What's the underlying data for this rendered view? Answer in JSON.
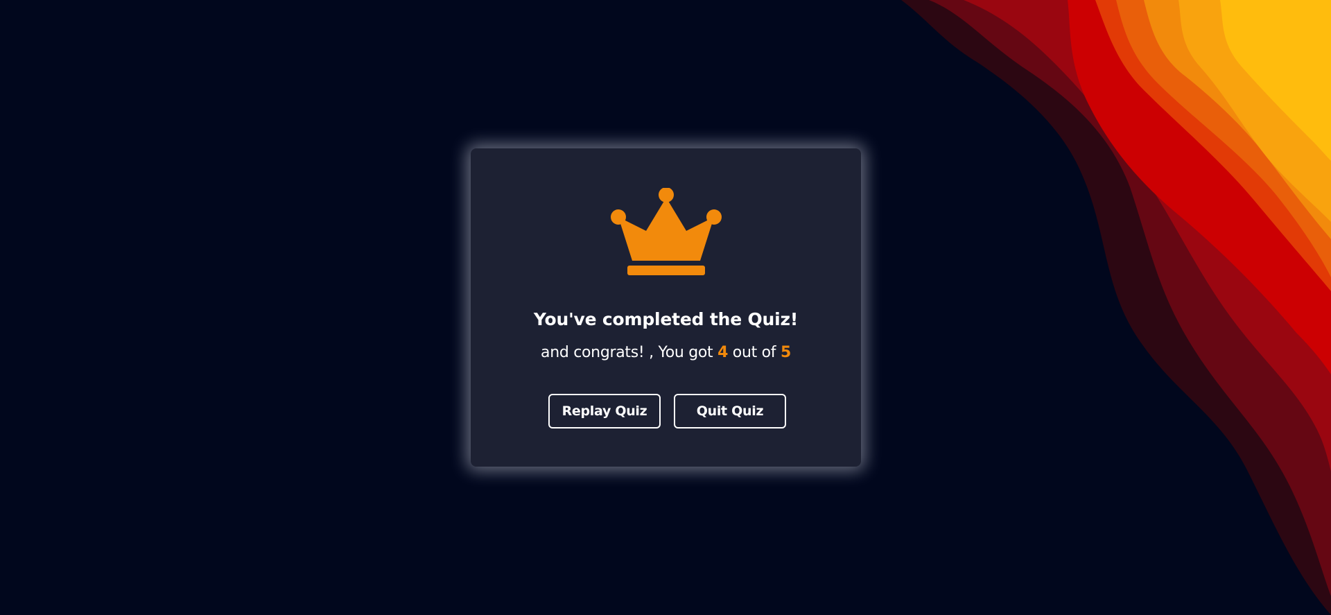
{
  "result": {
    "title": "You've completed the Quiz!",
    "score_prefix": "and congrats! , You got",
    "score_value": "4",
    "score_middle": "out of",
    "score_total": "5"
  },
  "buttons": {
    "replay_label": "Replay Quiz",
    "quit_label": "Quit Quiz"
  },
  "icons": {
    "crown": "crown-icon"
  },
  "colors": {
    "background": "#01071d",
    "card": "#1d2133",
    "accent": "#f28a0c",
    "text": "#ffffff"
  }
}
